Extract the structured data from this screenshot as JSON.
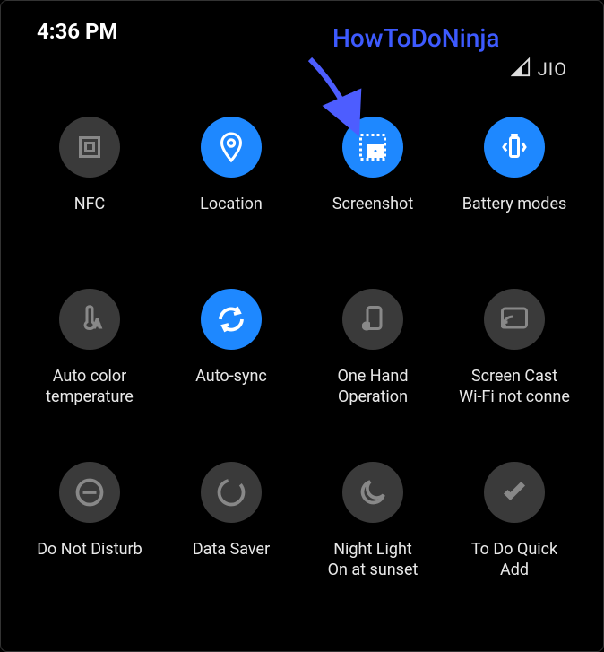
{
  "status": {
    "time": "4:36 PM",
    "carrier": "JIO"
  },
  "watermark": "HowToDoNinja",
  "tiles": [
    {
      "label": "NFC",
      "sublabel": "",
      "active": false
    },
    {
      "label": "Location",
      "sublabel": "",
      "active": true
    },
    {
      "label": "Screenshot",
      "sublabel": "",
      "active": true
    },
    {
      "label": "Battery modes",
      "sublabel": "",
      "active": true
    },
    {
      "label": "Auto color",
      "sublabel": "temperature",
      "active": false
    },
    {
      "label": "Auto-sync",
      "sublabel": "",
      "active": true
    },
    {
      "label": "One Hand",
      "sublabel": "Operation",
      "active": false
    },
    {
      "label": "Screen Cast",
      "sublabel": "Wi-Fi not conne",
      "active": false
    },
    {
      "label": "Do Not Disturb",
      "sublabel": "",
      "active": false
    },
    {
      "label": "Data Saver",
      "sublabel": "",
      "active": false
    },
    {
      "label": "Night Light",
      "sublabel": "On at sunset",
      "active": false
    },
    {
      "label": "To Do Quick",
      "sublabel": "Add",
      "active": false
    }
  ]
}
